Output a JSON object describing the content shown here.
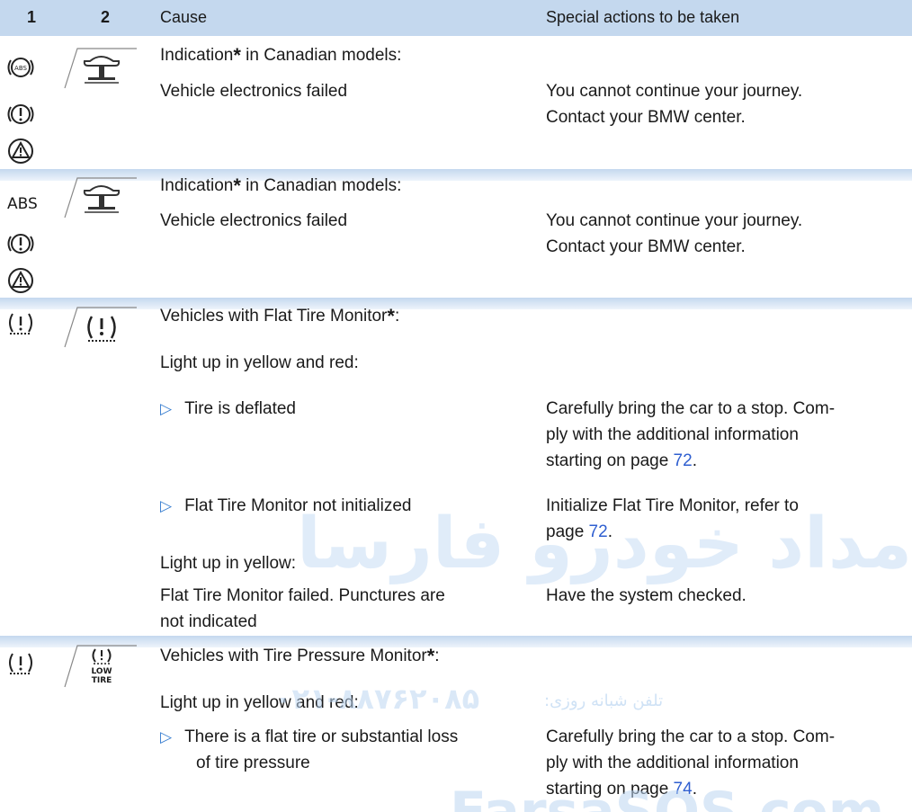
{
  "header": {
    "col1": "1",
    "col2": "2",
    "col3": "Cause",
    "col4": "Special actions to be taken"
  },
  "asterisk": "*",
  "sections": [
    {
      "icons": [
        "abs-circle-icon",
        "brake-warning-icon",
        "stability-triangle-icon"
      ],
      "intro_pre": "Indication",
      "intro_post": " in Canadian models:",
      "cause": "Vehicle electronics failed",
      "action_line1": "You cannot continue your journey.",
      "action_line2": "Contact your BMW center."
    },
    {
      "icons": [
        "abs-text-icon",
        "brake-warning-icon",
        "stability-triangle-icon"
      ],
      "abs_text": "ABS",
      "intro_pre": "Indication",
      "intro_post": " in Canadian models:",
      "cause": "Vehicle electronics failed",
      "action_line1": "You cannot continue your journey.",
      "action_line2": "Contact your BMW center."
    },
    {
      "icons": [
        "flat-tire-icon"
      ],
      "intro_pre": "Vehicles with Flat Tire Monitor",
      "intro_post": ":",
      "sub1": "Light up in yellow and red:",
      "bullet1": "Tire is deflated",
      "action1_line1": "Carefully bring the car to a stop. Com-",
      "action1_line2": "ply with the additional information",
      "action1_line3_pre": "starting on page ",
      "action1_page": "72",
      "action1_line3_post": ".",
      "bullet2": "Flat Tire Monitor not initialized",
      "action2_line1": "Initialize Flat Tire Monitor, refer to",
      "action2_line2_pre": "page ",
      "action2_page": "72",
      "action2_line2_post": ".",
      "sub2": "Light up in yellow:",
      "cause3_line1": "Flat Tire Monitor failed. Punctures are",
      "cause3_line2": "not indicated",
      "action3": "Have the system checked."
    },
    {
      "icons": [
        "tire-pressure-icon"
      ],
      "panel_label_line1": "LOW",
      "panel_label_line2": "TIRE",
      "intro_pre": "Vehicles with Tire Pressure Monitor",
      "intro_post": ":",
      "sub1": "Light up in yellow and red:",
      "bullet1_line1": "There is a flat tire or substantial loss",
      "bullet1_line2": "of tire pressure",
      "action1_line1": "Carefully bring the car to a stop. Com-",
      "action1_line2": "ply with the additional information",
      "action1_line3_pre": "starting on page ",
      "action1_page": "74",
      "action1_line3_post": "."
    }
  ],
  "bullet_glyph": "▷",
  "watermark": {
    "arabic_logo": "امداد خودرو فارسا",
    "phone_label": "تلفن شبانه روزی:",
    "phone_number": "۰۲۱-۸۸۷۶۲۰۸۵",
    "site": "FarsaSOS.com"
  },
  "colors": {
    "header_bg": "#c4d8ee",
    "link": "#2f5fd0",
    "bullet": "#3a7fd0"
  }
}
